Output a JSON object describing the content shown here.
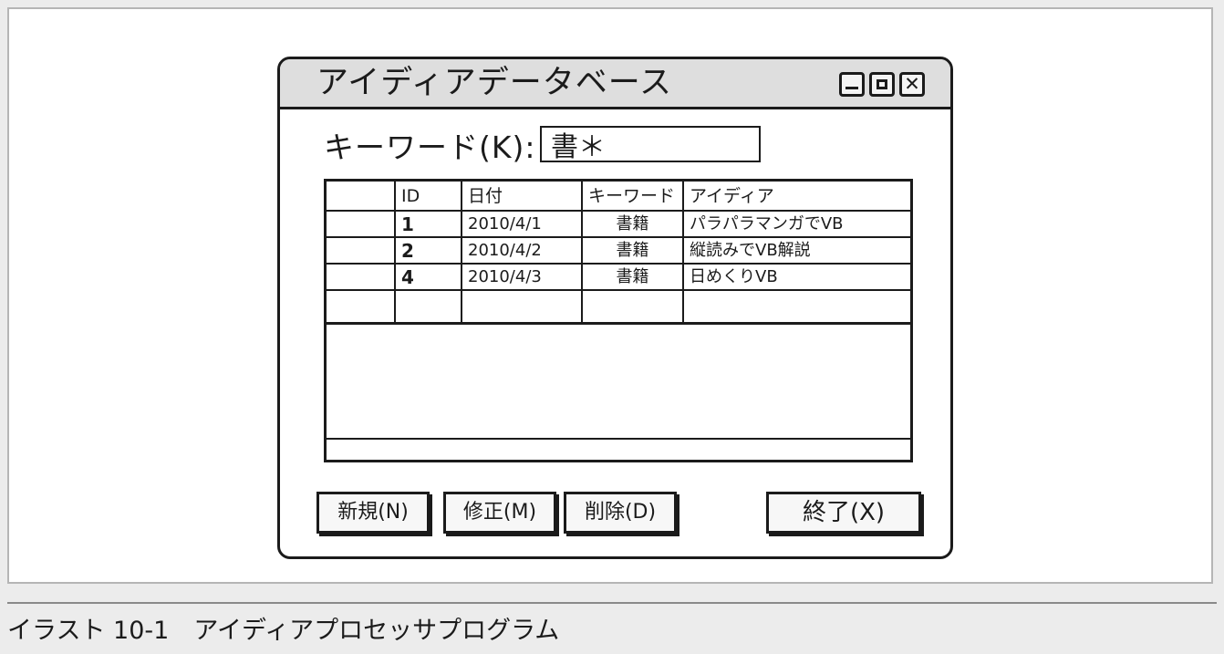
{
  "window": {
    "title": "アイディアデータベース",
    "buttons": {
      "minimize": "minimize-icon",
      "maximize": "maximize-icon",
      "close": "close-icon"
    }
  },
  "search": {
    "label": "キーワード(K):",
    "value": "書＊"
  },
  "table": {
    "columns": [
      "",
      "ID",
      "日付",
      "キーワード",
      "アイディア"
    ],
    "rows": [
      {
        "id": "1",
        "date": "2010/4/1",
        "keyword": "書籍",
        "idea": "パラパラマンガでVB"
      },
      {
        "id": "2",
        "date": "2010/4/2",
        "keyword": "書籍",
        "idea": "縦読みでVB解説"
      },
      {
        "id": "4",
        "date": "2010/4/3",
        "keyword": "書籍",
        "idea": "日めくりVB"
      }
    ]
  },
  "buttons": {
    "new": "新規(N)",
    "edit": "修正(M)",
    "delete": "削除(D)",
    "exit": "終了(X)"
  },
  "caption": "イラスト 10-1　アイディアプロセッサプログラム",
  "colors": {
    "title_bar": "#dedede",
    "ink": "#1b1b1b",
    "frame_border": "#b5b5b5",
    "background": "#ececec"
  }
}
